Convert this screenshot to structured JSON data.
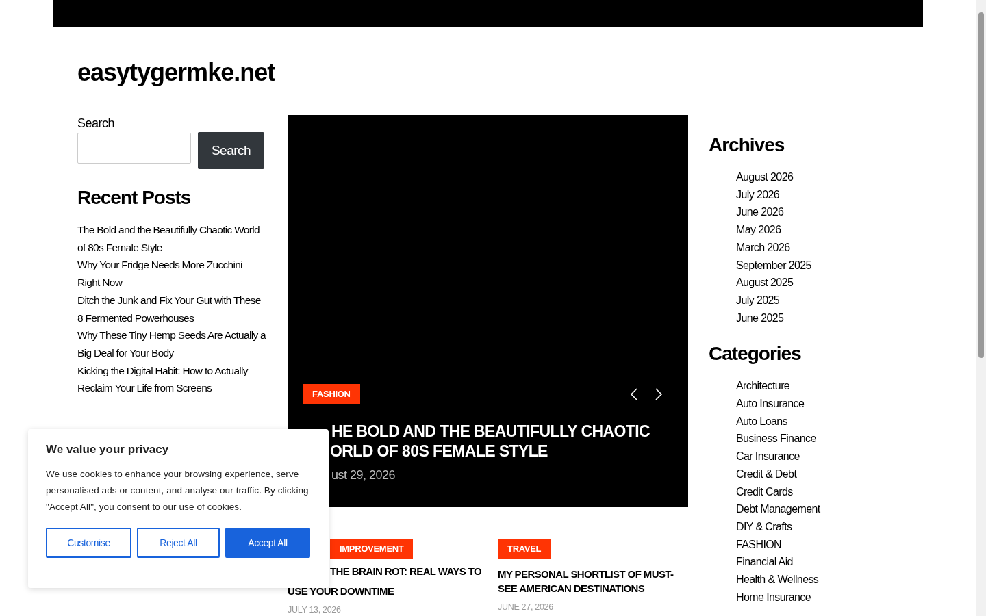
{
  "site_title": "easytygermke.net",
  "search": {
    "label": "Search",
    "button": "Search"
  },
  "recent_posts": {
    "title": "Recent Posts",
    "items": [
      {
        "title": "The Bold and the Beautifully Chaotic World of 80s Female Style"
      },
      {
        "title": "Why Your Fridge Needs More Zucchini Right Now"
      },
      {
        "title": "Ditch the Junk and Fix Your Gut with These 8 Fermented Powerhouses"
      },
      {
        "title": "Why These Tiny Hemp Seeds Are Actually a Big Deal for Your Body"
      },
      {
        "title": "Kicking the Digital Habit: How to Actually Reclaim Your Life from Screens"
      }
    ]
  },
  "hero": {
    "kind": "picture",
    "category": "FASHION",
    "title_lines": [
      "HE BOLD AND THE BEAUTIFULLY CHAOTIC",
      "ORLD OF 80S FEMALE STYLE"
    ],
    "date": "ust 29, 2026"
  },
  "posts": [
    {
      "category": "IMPROVEMENT",
      "title_lines": [
        "THE BRAIN ROT: REAL WAYS TO",
        "USE YOUR DOWNTIME"
      ],
      "date": "JULY 13, 2026"
    },
    {
      "category": "TRAVEL",
      "title_lines": [
        "MY PERSONAL SHORTLIST OF MUST-",
        "SEE AMERICAN DESTINATIONS"
      ],
      "date": "JUNE 27, 2026"
    }
  ],
  "archives": {
    "title": "Archives",
    "items": [
      "August 2026",
      "July 2026",
      "June 2026",
      "May 2026",
      "March 2026",
      "September 2025",
      "August 2025",
      "July 2025",
      "June 2025"
    ]
  },
  "categories": {
    "title": "Categories",
    "items": [
      "Architecture",
      "Auto Insurance",
      "Auto Loans",
      "Business Finance",
      "Car Insurance",
      "Credit & Debt",
      "Credit Cards",
      "Debt Management",
      "DIY & Crafts",
      "FASHION",
      "Financial Aid",
      "Health & Wellness",
      "Home Insurance"
    ]
  },
  "cookie": {
    "title": "We value your privacy",
    "text": "We use cookies to enhance your browsing experience, serve personalised ads or content, and analyse our traffic. By clicking \"Accept All\", you consent to our use of cookies.",
    "buttons": [
      {
        "label": "Customise",
        "kind": "outline"
      },
      {
        "label": "Reject All",
        "kind": "outline"
      },
      {
        "label": "Accept All",
        "kind": "primary"
      }
    ]
  }
}
